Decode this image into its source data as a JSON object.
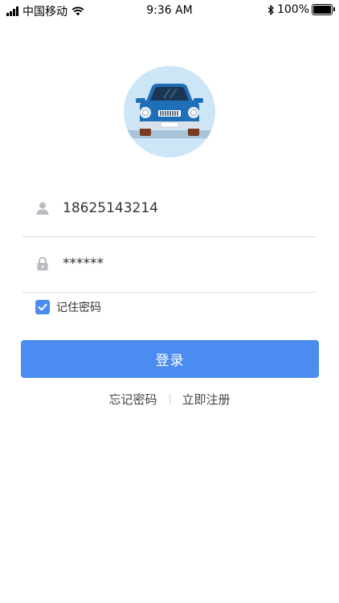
{
  "status_bar": {
    "carrier": "中国移动",
    "time": "9:36 AM",
    "battery": "100%"
  },
  "login": {
    "phone_value": "18625143214",
    "password_display": "******",
    "remember_label": "记住密码",
    "remember_checked": true,
    "login_button": "登录",
    "forgot_link": "忘记密码",
    "register_link": "立即注册"
  },
  "colors": {
    "primary": "#4a8cf0",
    "logo_bg": "#cde6f7",
    "car_body": "#1f6fb8"
  },
  "icons": [
    "signal-icon",
    "wifi-icon",
    "bluetooth-icon",
    "battery-icon",
    "car-logo-icon",
    "user-icon",
    "lock-icon",
    "check-icon"
  ]
}
